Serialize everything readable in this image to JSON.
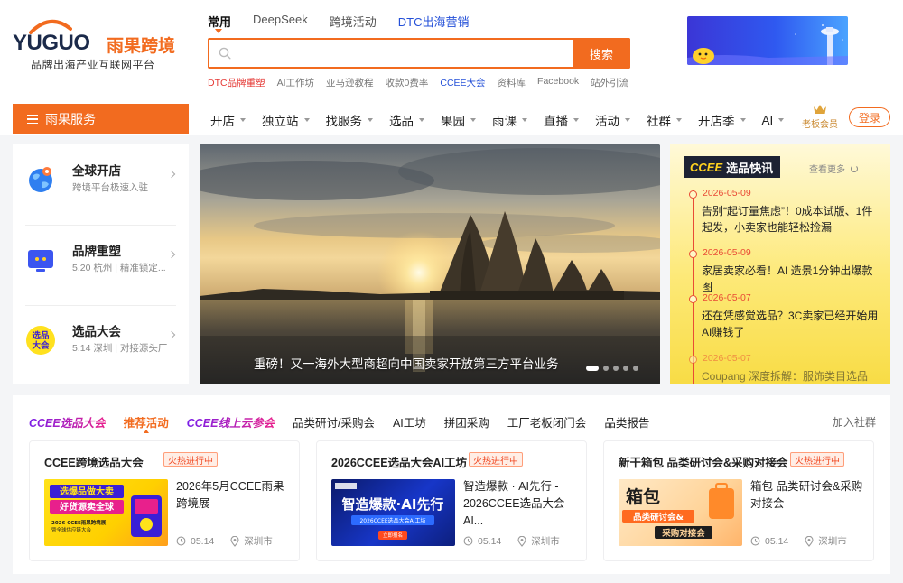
{
  "brand": {
    "logo_en": "YUGUO",
    "logo_cn": "雨果跨境",
    "tagline": "品牌出海产业互联网平台",
    "accent": "#f26b1f"
  },
  "search": {
    "tabs": [
      "常用",
      "DeepSeek",
      "跨境活动",
      "DTC出海营销"
    ],
    "active_tab": "常用",
    "placeholder": "",
    "button": "搜索",
    "hot_links": [
      "DTC品牌重塑",
      "AI工作坊",
      "亚马逊教程",
      "收款0费率",
      "CCEE大会",
      "资料库",
      "Facebook",
      "站外引流"
    ]
  },
  "nav": {
    "service_label": "雨果服务",
    "items": [
      "开店",
      "独立站",
      "找服务",
      "选品",
      "果园",
      "雨课",
      "直播",
      "活动",
      "社群",
      "开店季",
      "AI"
    ],
    "vip_label": "老板会员",
    "login_label": "登录"
  },
  "services": [
    {
      "title": "全球开店",
      "desc": "跨境平台极速入驻",
      "icon": "globe-icon"
    },
    {
      "title": "品牌重塑",
      "desc": "5.20 杭州 | 精准锁定...",
      "icon": "monitor-icon"
    },
    {
      "title": "选品大会",
      "desc": "5.14 深圳 | 对接源头厂",
      "icon": "xuanpin-badge-icon",
      "icon_text": "选品\n大会"
    }
  ],
  "hero": {
    "caption": "重磅！又一海外大型商超向中国卖家开放第三方平台业务",
    "slide_count": 5,
    "active_slide": 1
  },
  "news": {
    "badge_brand": "CCEE",
    "badge_title": "选品快讯",
    "more": "查看更多",
    "items": [
      {
        "date": "2026-05-09",
        "text": "告别“起订量焦虑”！0成本试版、1件起发，小卖家也能轻松捡漏"
      },
      {
        "date": "2026-05-09",
        "text": "家居卖家必看！AI 造景1分钟出爆款图"
      },
      {
        "date": "2026-05-07",
        "text": "还在凭感觉选品？3C卖家已经开始用AI赚钱了"
      },
      {
        "date": "2026-05-07",
        "text": "Coupang 深度拆解：服饰类目选品策"
      }
    ]
  },
  "events": {
    "tabs": [
      "CCEE选品大会",
      "推荐活动",
      "CCEE线上云参会",
      "品类研讨/采购会",
      "AI工坊",
      "拼团采购",
      "工厂老板闭门会",
      "品类报告"
    ],
    "active_tab": "推荐活动",
    "join": "加入社群",
    "hot_label": "火热进行中",
    "cards": [
      {
        "title": "CCEE跨境选品大会",
        "desc": "2026年5月CCEE雨果跨境展",
        "date": "05.14",
        "city": "深圳市",
        "thumb": {
          "line1": "选爆品做大卖",
          "line2": "好货源卖全球",
          "line3": "2026 CCEE雨果跨境展",
          "line4": "暨全球供应链大会"
        }
      },
      {
        "title": "2026CCEE选品大会AI工坊",
        "desc": "智造爆款 · AI先行 - 2026CCEE选品大会AI...",
        "date": "05.14",
        "city": "深圳市",
        "thumb": {
          "line1": "智造爆款·AI先行",
          "line2": "2026CCEE选品大会AI工坊",
          "line3": "立即报名"
        }
      },
      {
        "title": "新干箱包 品类研讨会&采购对接会",
        "desc": "箱包 品类研讨会&采购对接会",
        "date": "05.14",
        "city": "深圳市",
        "thumb": {
          "line1": "箱包",
          "line2": "品类研讨会&",
          "line3": "采购对接会"
        }
      }
    ]
  }
}
